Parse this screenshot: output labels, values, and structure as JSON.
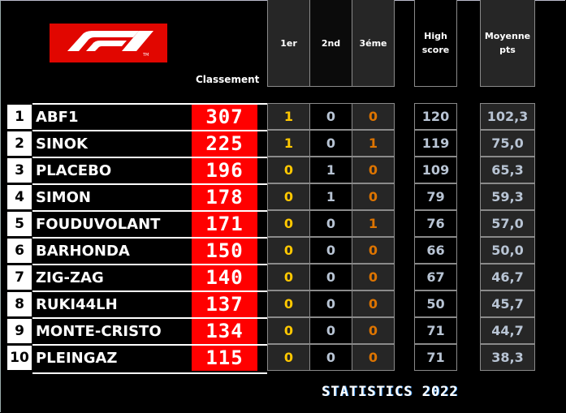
{
  "logo": {
    "name": "F1",
    "trademark": "TM",
    "color": "#e10600"
  },
  "header": {
    "ranking_label": "Classement",
    "columns": {
      "first": "1er",
      "second": "2nd",
      "third": "3éme",
      "high_score_line1": "High",
      "high_score_line2": "score",
      "average_line1": "Moyenne",
      "average_line2": "pts"
    }
  },
  "colors": {
    "score_bg": "#ff0000",
    "first_place": "#ffc800",
    "second_place": "#b8c4d4",
    "third_place": "#dd7400"
  },
  "rows": [
    {
      "rank": "1",
      "name": "ABF1",
      "points": "307",
      "first": "1",
      "second": "0",
      "third": "0",
      "high": "120",
      "avg": "102,3"
    },
    {
      "rank": "2",
      "name": "SINOK",
      "points": "225",
      "first": "1",
      "second": "0",
      "third": "1",
      "high": "119",
      "avg": "75,0"
    },
    {
      "rank": "3",
      "name": "PLACEBO",
      "points": "196",
      "first": "0",
      "second": "1",
      "third": "0",
      "high": "109",
      "avg": "65,3"
    },
    {
      "rank": "4",
      "name": "SIMON",
      "points": "178",
      "first": "0",
      "second": "1",
      "third": "0",
      "high": "79",
      "avg": "59,3"
    },
    {
      "rank": "5",
      "name": "FOUDUVOLANT",
      "points": "171",
      "first": "0",
      "second": "0",
      "third": "1",
      "high": "76",
      "avg": "57,0"
    },
    {
      "rank": "6",
      "name": "BARHONDA",
      "points": "150",
      "first": "0",
      "second": "0",
      "third": "0",
      "high": "66",
      "avg": "50,0"
    },
    {
      "rank": "7",
      "name": "ZIG-ZAG",
      "points": "140",
      "first": "0",
      "second": "0",
      "third": "0",
      "high": "67",
      "avg": "46,7"
    },
    {
      "rank": "8",
      "name": "RUKI44LH",
      "points": "137",
      "first": "0",
      "second": "0",
      "third": "0",
      "high": "50",
      "avg": "45,7"
    },
    {
      "rank": "9",
      "name": "MONTE-CRISTO",
      "points": "134",
      "first": "0",
      "second": "0",
      "third": "0",
      "high": "71",
      "avg": "44,7"
    },
    {
      "rank": "10",
      "name": "PLEINGAZ",
      "points": "115",
      "first": "0",
      "second": "0",
      "third": "0",
      "high": "71",
      "avg": "38,3"
    }
  ],
  "footer": {
    "title": "STATISTICS 2022"
  }
}
